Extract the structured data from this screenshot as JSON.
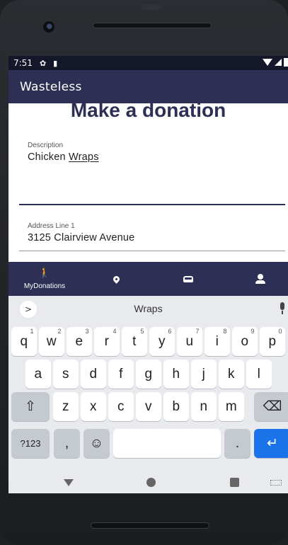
{
  "status_bar": {
    "time": "7:51"
  },
  "app_bar": {
    "title": "Wasteless"
  },
  "form": {
    "title": "Make a donation",
    "description": {
      "label": "Description",
      "value_part1": "Chicken ",
      "value_part2": "Wraps"
    },
    "address_line1": {
      "label": "Address Line 1",
      "value": "3125 Clairview Avenue"
    }
  },
  "bottom_nav": {
    "items": [
      {
        "label": "MyDonations",
        "icon": "pedestrian-icon"
      },
      {
        "label": "",
        "icon": "location-pin-icon"
      },
      {
        "label": "",
        "icon": "car-icon"
      },
      {
        "label": "",
        "icon": "person-icon"
      }
    ]
  },
  "keyboard": {
    "suggestion": "Wraps",
    "row1": [
      {
        "k": "q",
        "h": "1"
      },
      {
        "k": "w",
        "h": "2"
      },
      {
        "k": "e",
        "h": "3"
      },
      {
        "k": "r",
        "h": "4"
      },
      {
        "k": "t",
        "h": "5"
      },
      {
        "k": "y",
        "h": "6"
      },
      {
        "k": "u",
        "h": "7"
      },
      {
        "k": "i",
        "h": "8"
      },
      {
        "k": "o",
        "h": "9"
      },
      {
        "k": "p",
        "h": "0"
      }
    ],
    "row2": [
      "a",
      "s",
      "d",
      "f",
      "g",
      "h",
      "j",
      "k",
      "l"
    ],
    "row3": [
      "z",
      "x",
      "c",
      "v",
      "b",
      "n",
      "m"
    ],
    "symbols_label": "?123",
    "comma_label": ",",
    "period_label": ".",
    "emoji_glyph": "☺",
    "shift_glyph": "⇧",
    "backspace_glyph": "⌫",
    "enter_glyph": "↵",
    "expand_glyph": ">"
  },
  "colors": {
    "primary": "#2d3054",
    "status_bar": "#15172b",
    "enter_key": "#1a73e8"
  }
}
